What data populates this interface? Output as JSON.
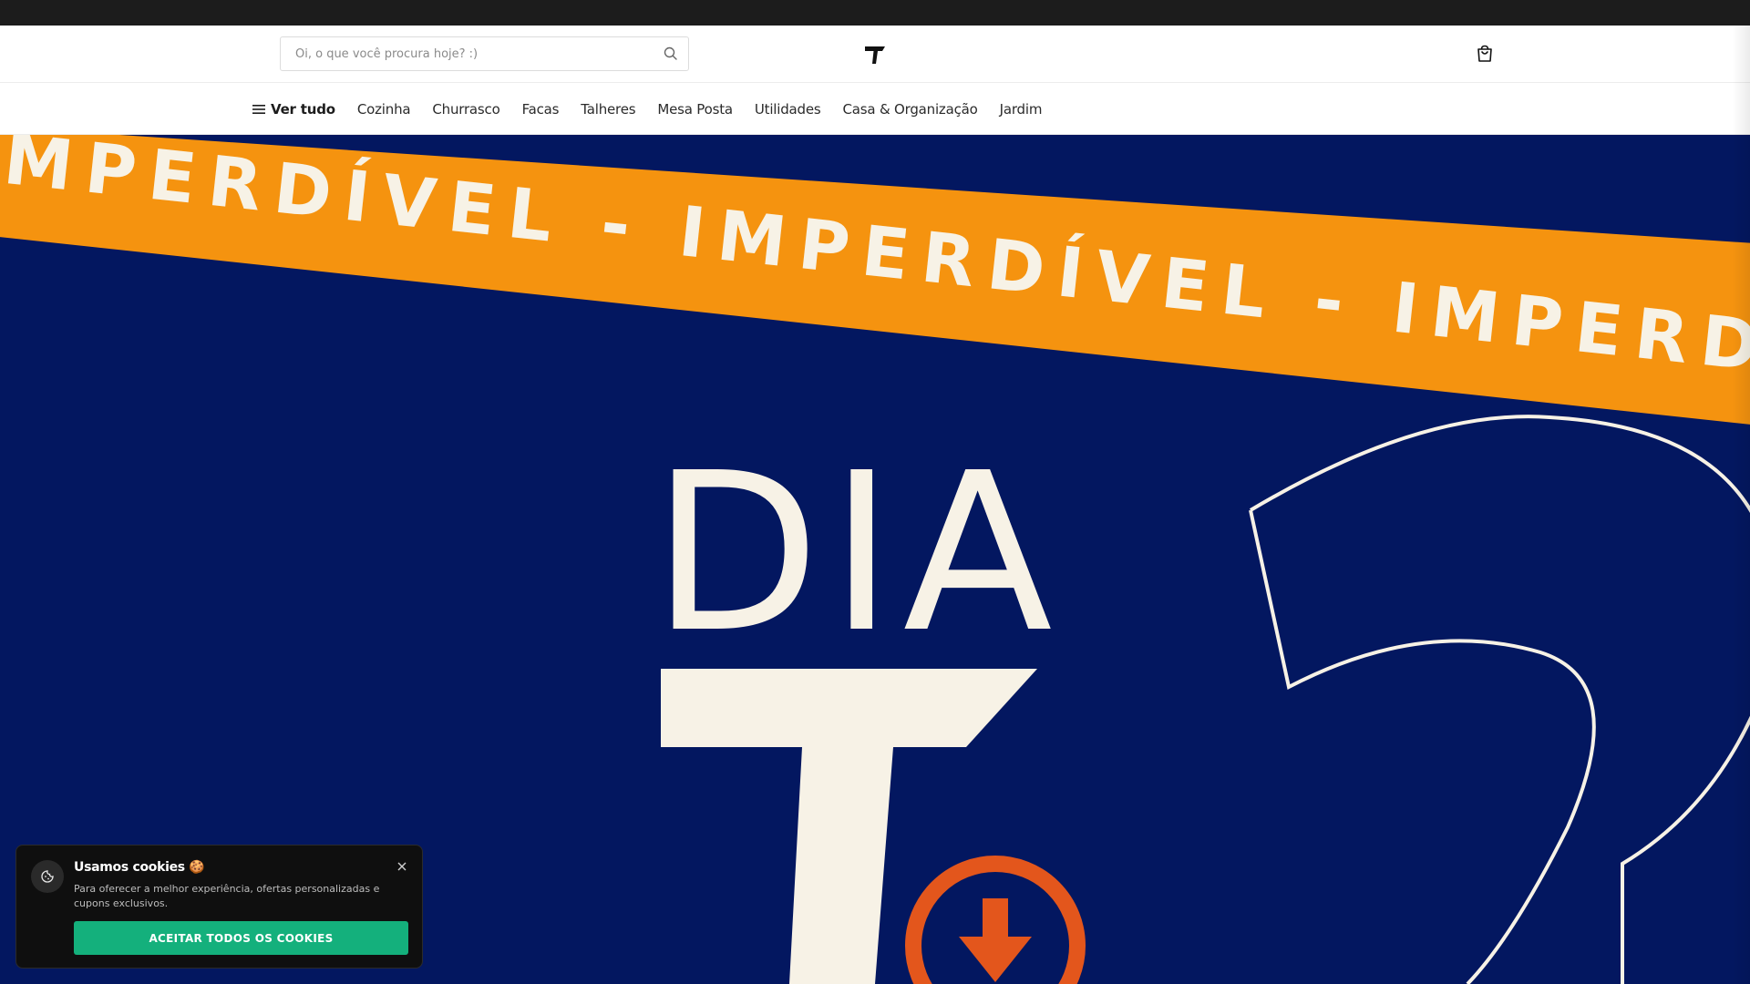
{
  "search": {
    "placeholder": "Oi, o que você procura hoje? :)"
  },
  "nav": {
    "all_label": "Ver tudo",
    "items": [
      "Cozinha",
      "Churrasco",
      "Facas",
      "Talheres",
      "Mesa Posta",
      "Utilidades",
      "Casa & Organização",
      "Jardim"
    ]
  },
  "hero": {
    "banner_text": "IMPERDÍVEL - IMPERDÍVEL - IMPERDÍVE",
    "headline": "DIA",
    "colors": {
      "background": "#031760",
      "stripe": "#f5930f",
      "accent": "#e3561c",
      "text": "#f7f2e6"
    }
  },
  "cookie": {
    "title": "Usamos cookies 🍪",
    "text": "Para oferecer a melhor experiência, ofertas personalizadas e cupons exclusivos.",
    "button_label": "ACEITAR TODOS OS COOKIES",
    "button_color": "#14b07c"
  },
  "icons": {
    "search": "search-icon",
    "logo": "brand-logo-icon",
    "cart": "shopping-bag-icon",
    "menu": "hamburger-icon",
    "cookie": "cookie-icon",
    "close": "close-icon"
  }
}
